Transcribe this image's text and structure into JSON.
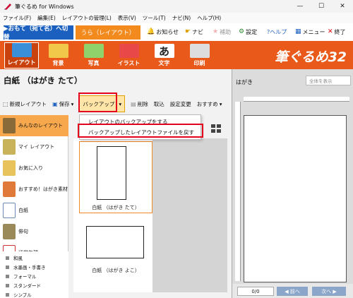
{
  "window": {
    "title": "筆ぐるめ for Windows",
    "controls": {
      "minimize": "—",
      "maximize": "☐",
      "close": "✕"
    }
  },
  "menubar": [
    "ファイル(F)",
    "編集(E)",
    "レイアウトの管理(L)",
    "表示(V)",
    "ツール(T)",
    "ナビ(N)",
    "ヘルプ(H)"
  ],
  "mode_tabs": {
    "omote": "▶おもて（宛て名）へ切替",
    "ura": "うら（レイアウト）"
  },
  "top_buttons": [
    {
      "label": "お知らせ",
      "icon": "bell-icon",
      "glyph": "🔔"
    },
    {
      "label": "ナビ",
      "icon": "pointer-icon",
      "glyph": "☛"
    },
    {
      "label": "補助",
      "icon": "star-icon",
      "glyph": "★"
    },
    {
      "label": "設定",
      "icon": "gear-icon",
      "glyph": "⚙"
    },
    {
      "label": "?ヘルプ",
      "icon": "help-icon",
      "glyph": ""
    },
    {
      "label": "メニュー",
      "icon": "menu-icon",
      "glyph": "▦"
    },
    {
      "label": "終了",
      "icon": "close-icon",
      "glyph": "✕"
    }
  ],
  "ribbon": {
    "tabs": [
      "レイアウト",
      "背景",
      "写真",
      "イラスト",
      "文字",
      "印刷"
    ],
    "brand": "筆ぐるめ32",
    "color": "#e8591a"
  },
  "page_title": "白紙 （はがき たて）",
  "toolbar": {
    "new_layout": "新規レイアウト",
    "save": "保存",
    "backup": "バックアップ",
    "delete": "削除",
    "import": "取込",
    "change_settings": "設定変更",
    "recommended": "おすすめ"
  },
  "dropdown": {
    "item1": "レイアウトのバックアップをする",
    "item2": "バックアップしたレイアウトファイルを戻す"
  },
  "categories": [
    "みんなのレイアウト",
    "マイ レイアウト",
    "お気に入り",
    "おすすめ！はがき素材",
    "白紙",
    "俳句",
    "通常年賀"
  ],
  "subcategories": [
    "和風",
    "水墨画・手書き",
    "フォーマル",
    "スタンダード",
    "シンプル"
  ],
  "thumbnails": [
    {
      "label": "白紙 （はがき たて）"
    },
    {
      "label": "白紙 （はがき よこ）"
    }
  ],
  "preview": {
    "title": "はがき",
    "select_placeholder": "全体を表示",
    "page_counter": "0/0",
    "prev": "◀ 前へ",
    "next": "次へ ▶"
  }
}
